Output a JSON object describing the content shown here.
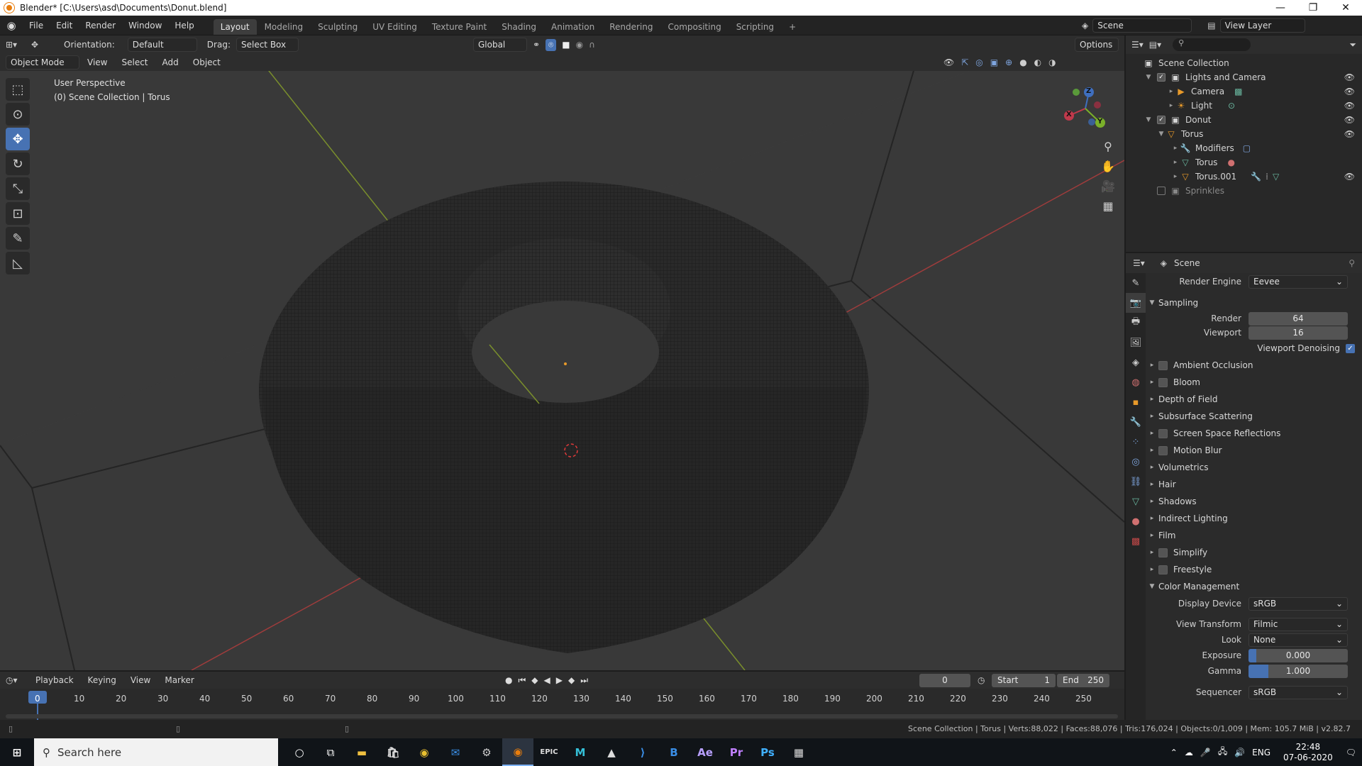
{
  "window": {
    "title": "Blender* [C:\\Users\\asd\\Documents\\Donut.blend]",
    "minimize": "—",
    "maximize": "❐",
    "close": "✕"
  },
  "menu": {
    "items": [
      "File",
      "Edit",
      "Render",
      "Window",
      "Help"
    ]
  },
  "workspaces": [
    "Layout",
    "Modeling",
    "Sculpting",
    "UV Editing",
    "Texture Paint",
    "Shading",
    "Animation",
    "Rendering",
    "Compositing",
    "Scripting",
    "+"
  ],
  "topright": {
    "scene": "Scene",
    "view_layer": "View Layer"
  },
  "tool_header": {
    "orientation_label": "Orientation:",
    "orientation_value": "Default",
    "drag_label": "Drag:",
    "drag_value": "Select Box",
    "transform_orient": "Global",
    "options": "Options"
  },
  "viewport_header": {
    "mode": "Object Mode",
    "menus": [
      "View",
      "Select",
      "Add",
      "Object"
    ]
  },
  "viewport": {
    "perspective": "User Perspective",
    "collection": "(0) Scene Collection | Torus"
  },
  "gizmo": {
    "x": "X",
    "y": "Y",
    "z": "Z"
  },
  "outliner": {
    "root": "Scene Collection",
    "rows": [
      {
        "label": "Lights and Camera",
        "icon": "collection-icon"
      },
      {
        "label": "Camera",
        "icon": "camera-icon"
      },
      {
        "label": "Light",
        "icon": "light-icon"
      },
      {
        "label": "Donut",
        "icon": "collection-icon"
      },
      {
        "label": "Torus",
        "icon": "mesh-object-icon"
      },
      {
        "label": "Modifiers",
        "icon": "wrench-icon"
      },
      {
        "label": "Torus",
        "icon": "mesh-data-icon"
      },
      {
        "label": "Torus.001",
        "icon": "mesh-object-icon"
      },
      {
        "label": "Sprinkles",
        "icon": "collection-icon"
      }
    ]
  },
  "properties": {
    "header": "Scene",
    "render_engine_label": "Render Engine",
    "render_engine": "Eevee",
    "sampling": {
      "title": "Sampling",
      "render_label": "Render",
      "render": "64",
      "viewport_label": "Viewport",
      "viewport": "16",
      "denoise_label": "Viewport Denoising"
    },
    "sections": [
      {
        "label": "Ambient Occlusion",
        "checkbox": true
      },
      {
        "label": "Bloom",
        "checkbox": true
      },
      {
        "label": "Depth of Field",
        "checkbox": false
      },
      {
        "label": "Subsurface Scattering",
        "checkbox": false
      },
      {
        "label": "Screen Space Reflections",
        "checkbox": true
      },
      {
        "label": "Motion Blur",
        "checkbox": true
      },
      {
        "label": "Volumetrics",
        "checkbox": false
      },
      {
        "label": "Hair",
        "checkbox": false
      },
      {
        "label": "Shadows",
        "checkbox": false
      },
      {
        "label": "Indirect Lighting",
        "checkbox": false
      },
      {
        "label": "Film",
        "checkbox": false
      },
      {
        "label": "Simplify",
        "checkbox": true
      },
      {
        "label": "Freestyle",
        "checkbox": true
      }
    ],
    "color_management": {
      "title": "Color Management",
      "display_device_label": "Display Device",
      "display_device": "sRGB",
      "view_transform_label": "View Transform",
      "view_transform": "Filmic",
      "look_label": "Look",
      "look": "None",
      "exposure_label": "Exposure",
      "exposure": "0.000",
      "gamma_label": "Gamma",
      "gamma": "1.000",
      "sequencer_label": "Sequencer",
      "sequencer": "sRGB"
    }
  },
  "timeline": {
    "menus": [
      "Playback",
      "Keying",
      "View",
      "Marker"
    ],
    "current_frame": "0",
    "start_label": "Start",
    "start": "1",
    "end_label": "End",
    "end": "250",
    "ticks": [
      "0",
      "10",
      "20",
      "30",
      "40",
      "50",
      "60",
      "70",
      "80",
      "90",
      "100",
      "110",
      "120",
      "130",
      "140",
      "150",
      "160",
      "170",
      "180",
      "190",
      "200",
      "210",
      "220",
      "230",
      "240",
      "250"
    ]
  },
  "status": {
    "text": "Scene Collection | Torus | Verts:88,022 | Faces:88,076 | Tris:176,024 | Objects:0/1,009 | Mem: 105.7 MiB | v2.82.7"
  },
  "taskbar": {
    "search_placeholder": "Search here",
    "apps": [
      "Ae",
      "Pr",
      "Ps"
    ],
    "lang": "ENG",
    "time": "22:48",
    "date": "07-06-2020"
  }
}
